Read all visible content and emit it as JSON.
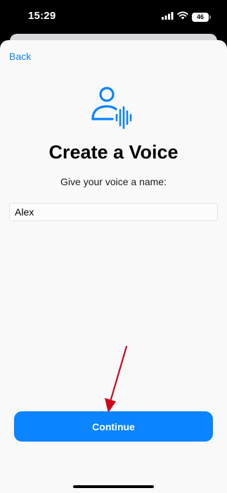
{
  "status_bar": {
    "time": "15:29",
    "battery": "46",
    "icons": [
      "signal-icon",
      "wifi-icon",
      "battery-icon"
    ]
  },
  "nav": {
    "back_label": "Back"
  },
  "header": {
    "icon": "person-voice-icon",
    "title": "Create a Voice",
    "subtitle": "Give your voice a name:"
  },
  "form": {
    "name_value": "Alex"
  },
  "annotation": {
    "icon": "red-arrow-icon",
    "color": "#d0021b"
  },
  "actions": {
    "continue_label": "Continue"
  },
  "colors": {
    "accent": "#0a84ff",
    "background": "#f9f9f9"
  }
}
